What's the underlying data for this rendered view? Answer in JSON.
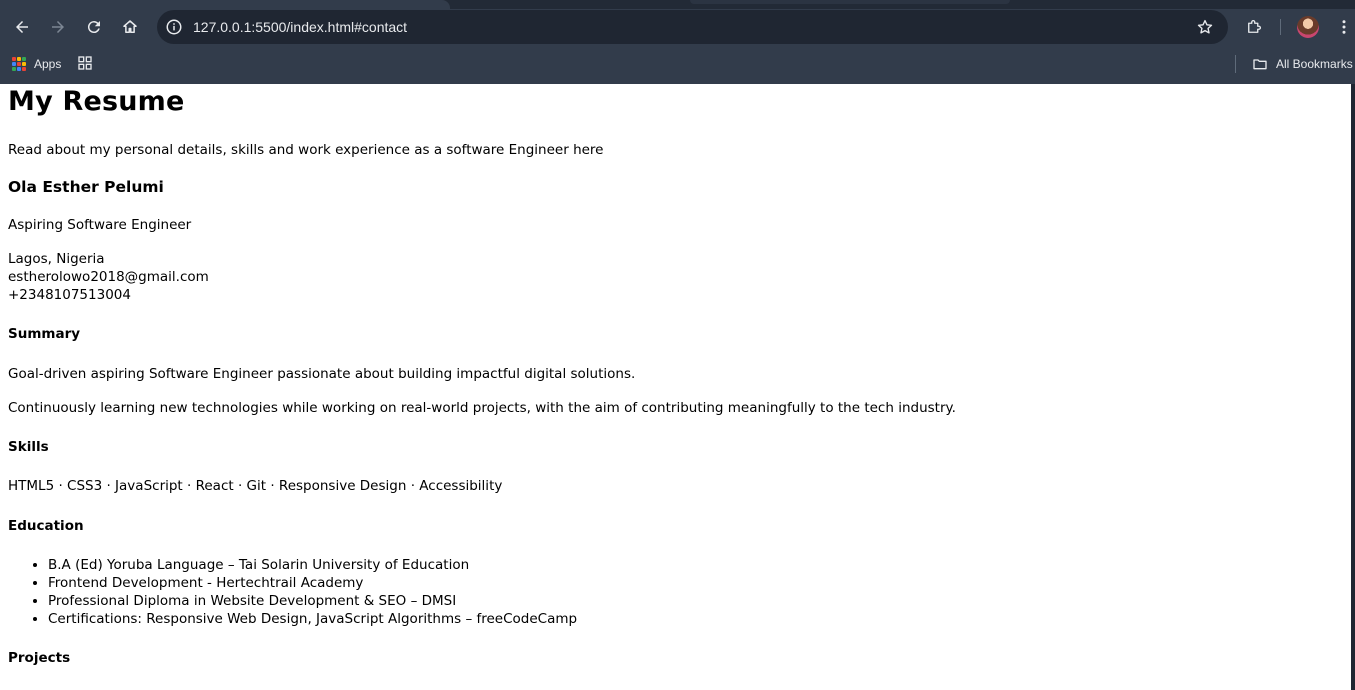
{
  "browser": {
    "url": "127.0.0.1:5500/index.html#contact",
    "bookmarks": {
      "apps_label": "Apps",
      "all_bookmarks_label": "All Bookmarks"
    }
  },
  "resume": {
    "title": "My Resume",
    "intro": "Read about my personal details, skills and work experience as a software Engineer here",
    "name": "Ola Esther Pelumi",
    "role": "Aspiring Software Engineer",
    "location": "Lagos, Nigeria",
    "email": "estherolowo2018@gmail.com",
    "phone": "+2348107513004",
    "summary": {
      "heading": "Summary",
      "paragraphs": [
        "Goal-driven aspiring Software Engineer passionate about building impactful digital solutions.",
        "Continuously learning new technologies while working on real-world projects, with the aim of contributing meaningfully to the tech industry."
      ]
    },
    "skills": {
      "heading": "Skills",
      "text": "HTML5 · CSS3 · JavaScript · React · Git · Responsive Design · Accessibility"
    },
    "education": {
      "heading": "Education",
      "items": [
        "B.A (Ed) Yoruba Language – Tai Solarin University of Education",
        "Frontend Development - Hertechtrail Academy",
        "Professional Diploma in Website Development & SEO – DMSI",
        "Certifications: Responsive Web Design, JavaScript Algorithms – freeCodeCamp"
      ]
    },
    "projects": {
      "heading": "Projects"
    }
  }
}
